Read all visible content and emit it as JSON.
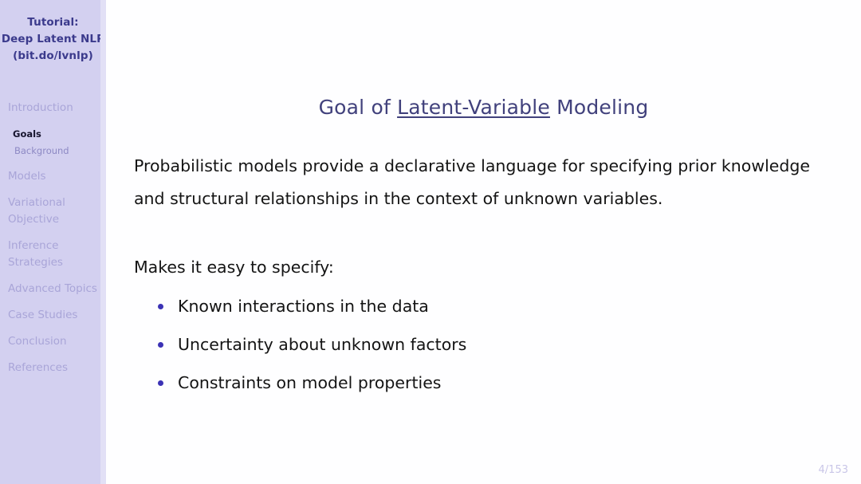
{
  "sidebar": {
    "title_lines": [
      "Tutorial:",
      "Deep Latent NLP",
      "(bit.do/lvnlp)"
    ],
    "nav": [
      {
        "label": "Introduction",
        "type": "section"
      },
      {
        "label": "Goals",
        "type": "subsection",
        "active": true
      },
      {
        "label": "Background",
        "type": "subsection",
        "active": false
      },
      {
        "label": "Models",
        "type": "section"
      },
      {
        "label": "Variational",
        "label2": "Objective",
        "type": "section"
      },
      {
        "label": "Inference",
        "label2": "Strategies",
        "type": "section"
      },
      {
        "label": "Advanced Topics",
        "type": "section"
      },
      {
        "label": "Case Studies",
        "type": "section"
      },
      {
        "label": "Conclusion",
        "type": "section"
      },
      {
        "label": "References",
        "type": "section"
      }
    ]
  },
  "slide": {
    "title_prefix": "Goal of ",
    "title_underlined": "Latent-Variable",
    "title_suffix": " Modeling",
    "paragraph": "Probabilistic models provide a declarative language for specifying prior knowledge and structural relationships in the context of unknown variables.",
    "lead_in": "Makes it easy to specify:",
    "bullets": [
      "Known interactions in the data",
      "Uncertainty about unknown factors",
      "Constraints on model properties"
    ],
    "page_number": "4/153"
  },
  "colors": {
    "sidebar_bg": "#d3d0f0",
    "sidebar_edge": "#e2e0f6",
    "title_color": "#41417c",
    "bullet_color": "#3b32b5",
    "nav_inactive": "#a9a5d8",
    "nav_active": "#16142e",
    "page_num_color": "#c9c6e8",
    "body_text": "#141414"
  }
}
